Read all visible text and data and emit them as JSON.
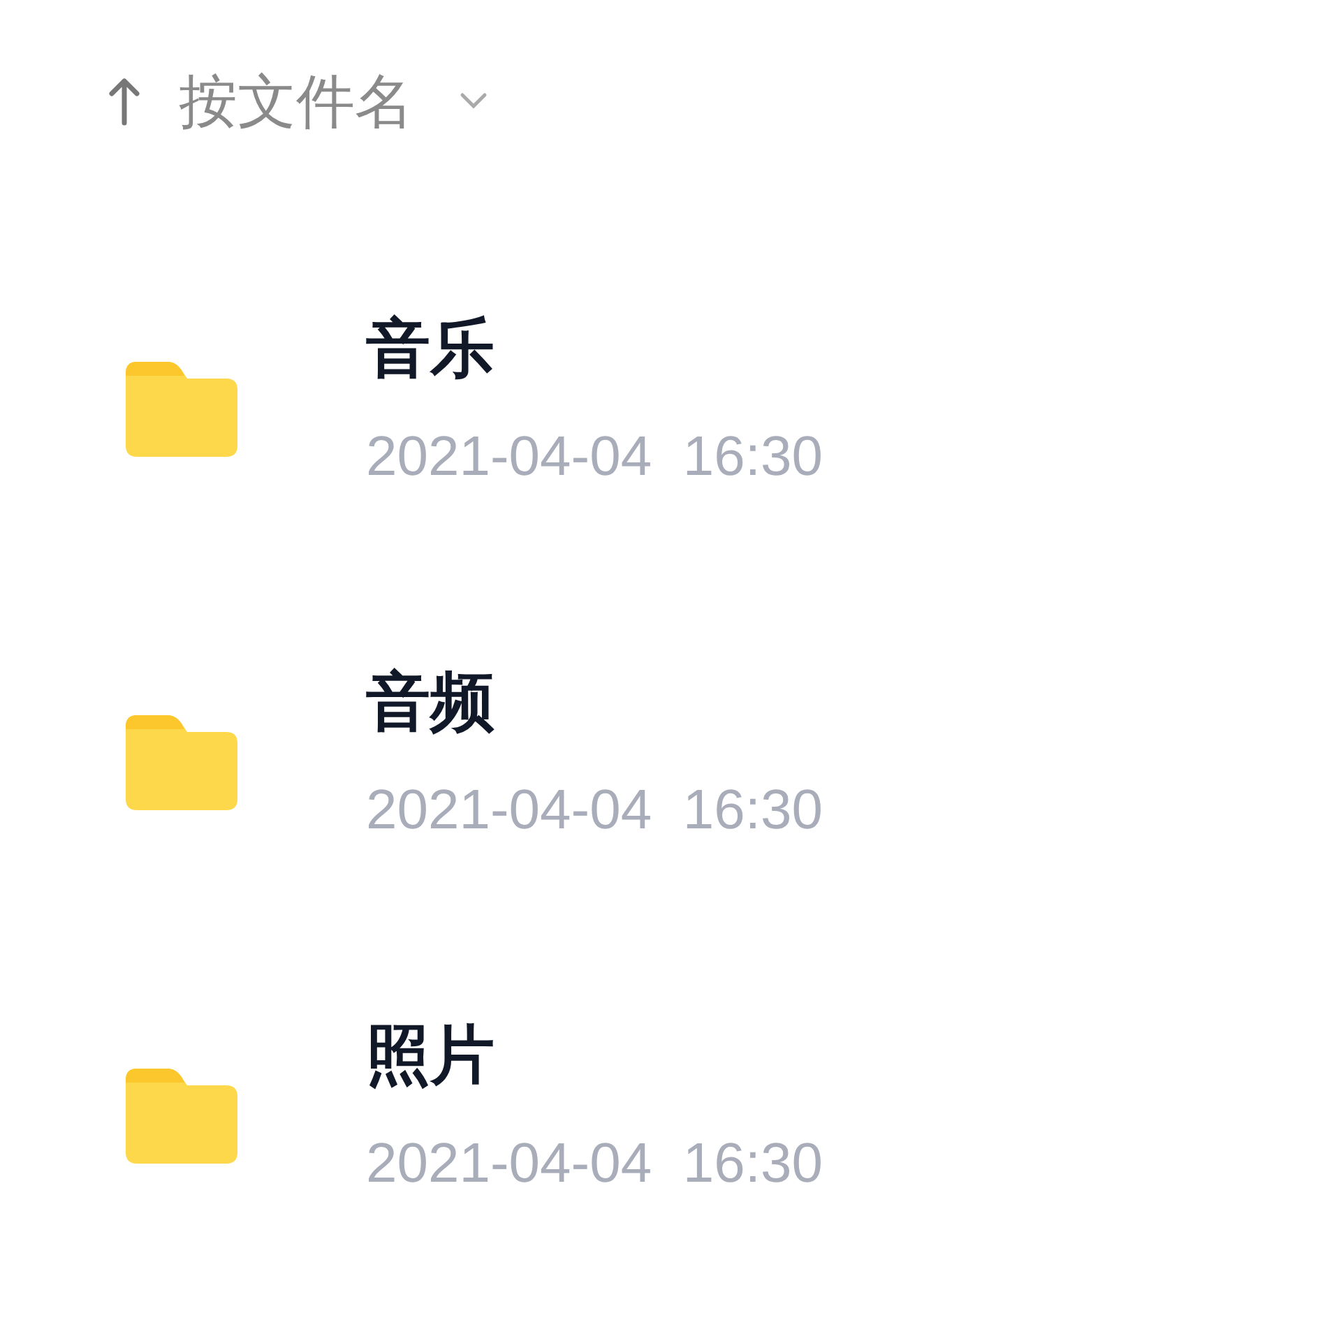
{
  "sort": {
    "label": "按文件名"
  },
  "folders": [
    {
      "name": "音乐",
      "date": "2021-04-04  16:30"
    },
    {
      "name": "音频",
      "date": "2021-04-04  16:30"
    },
    {
      "name": "照片",
      "date": "2021-04-04  16:30"
    }
  ]
}
